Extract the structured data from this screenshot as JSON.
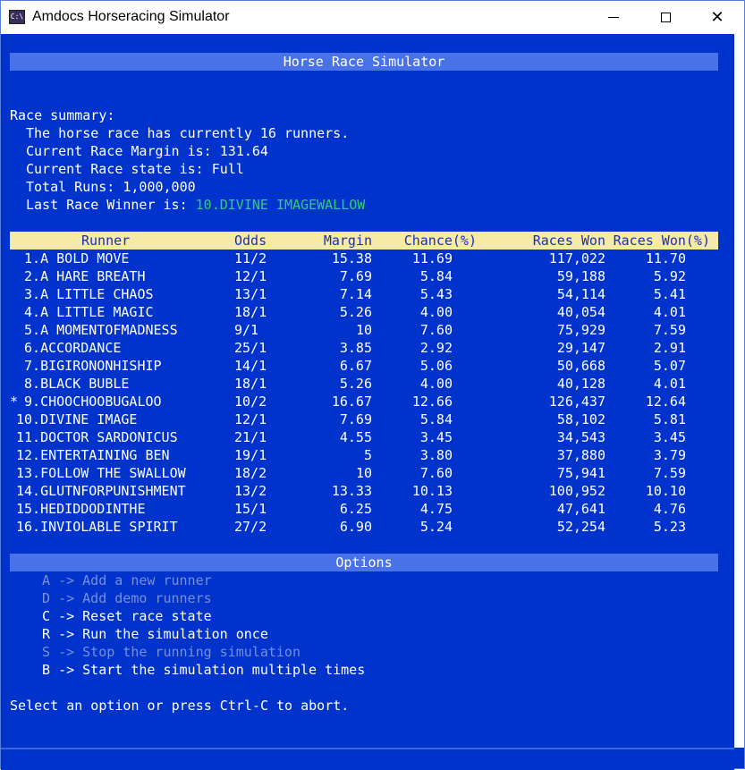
{
  "window": {
    "title": "Amdocs Horseracing Simulator",
    "icon": "console-app-icon"
  },
  "banner": {
    "title": "Horse Race Simulator"
  },
  "summary": {
    "heading": "Race summary:",
    "runners_line": "The horse race has currently 16 runners.",
    "margin_line": "Current Race Margin is: 131.64",
    "state_line": "Current Race state is: Full",
    "runs_line": "Total Runs: 1,000,000",
    "winner_label": "Last Race Winner is: ",
    "winner_value": "10.DIVINE IMAGEWALLOW",
    "winner_color": "#2fd16a"
  },
  "table": {
    "columns": [
      "Runner",
      "Odds",
      "Margin",
      "Chance(%)",
      "Races Won",
      "Races Won(%)"
    ],
    "rows": [
      {
        "marker": "",
        "runner": " 1.A BOLD MOVE",
        "odds": "11/2",
        "margin": "15.38",
        "chance": "11.69",
        "won": "117,022",
        "won_pct": "11.70"
      },
      {
        "marker": "",
        "runner": " 2.A HARE BREATH",
        "odds": "12/1",
        "margin": "7.69",
        "chance": "5.84",
        "won": "59,188",
        "won_pct": "5.92"
      },
      {
        "marker": "",
        "runner": " 3.A LITTLE CHAOS",
        "odds": "13/1",
        "margin": "7.14",
        "chance": "5.43",
        "won": "54,114",
        "won_pct": "5.41"
      },
      {
        "marker": "",
        "runner": " 4.A LITTLE MAGIC",
        "odds": "18/1",
        "margin": "5.26",
        "chance": "4.00",
        "won": "40,054",
        "won_pct": "4.01"
      },
      {
        "marker": "",
        "runner": " 5.A MOMENTOFMADNESS",
        "odds": "9/1",
        "margin": "10",
        "chance": "7.60",
        "won": "75,929",
        "won_pct": "7.59"
      },
      {
        "marker": "",
        "runner": " 6.ACCORDANCE",
        "odds": "25/1",
        "margin": "3.85",
        "chance": "2.92",
        "won": "29,147",
        "won_pct": "2.91"
      },
      {
        "marker": "",
        "runner": " 7.BIGIRONONHISHIP",
        "odds": "14/1",
        "margin": "6.67",
        "chance": "5.06",
        "won": "50,668",
        "won_pct": "5.07"
      },
      {
        "marker": "",
        "runner": " 8.BLACK BUBLE",
        "odds": "18/1",
        "margin": "5.26",
        "chance": "4.00",
        "won": "40,128",
        "won_pct": "4.01"
      },
      {
        "marker": "*",
        "runner": " 9.CHOOCHOOBUGALOO",
        "odds": "10/2",
        "margin": "16.67",
        "chance": "12.66",
        "won": "126,437",
        "won_pct": "12.64"
      },
      {
        "marker": "",
        "runner": "10.DIVINE IMAGE",
        "odds": "12/1",
        "margin": "7.69",
        "chance": "5.84",
        "won": "58,102",
        "won_pct": "5.81"
      },
      {
        "marker": "",
        "runner": "11.DOCTOR SARDONICUS",
        "odds": "21/1",
        "margin": "4.55",
        "chance": "3.45",
        "won": "34,543",
        "won_pct": "3.45"
      },
      {
        "marker": "",
        "runner": "12.ENTERTAINING BEN",
        "odds": "19/1",
        "margin": "5",
        "chance": "3.80",
        "won": "37,880",
        "won_pct": "3.79"
      },
      {
        "marker": "",
        "runner": "13.FOLLOW THE SWALLOW",
        "odds": "18/2",
        "margin": "10",
        "chance": "7.60",
        "won": "75,941",
        "won_pct": "7.59"
      },
      {
        "marker": "",
        "runner": "14.GLUTNFORPUNISHMENT",
        "odds": "13/2",
        "margin": "13.33",
        "chance": "10.13",
        "won": "100,952",
        "won_pct": "10.10"
      },
      {
        "marker": "",
        "runner": "15.HEDIDDODINTHE",
        "odds": "15/1",
        "margin": "6.25",
        "chance": "4.75",
        "won": "47,641",
        "won_pct": "4.76"
      },
      {
        "marker": "",
        "runner": "16.INVIOLABLE SPIRIT",
        "odds": "27/2",
        "margin": "6.90",
        "chance": "5.24",
        "won": "52,254",
        "won_pct": "5.23"
      }
    ]
  },
  "options": {
    "title": "Options",
    "items": [
      {
        "key": "A",
        "label": "Add a new runner",
        "enabled": false
      },
      {
        "key": "D",
        "label": "Add demo runners",
        "enabled": false
      },
      {
        "key": "C",
        "label": "Reset race state",
        "enabled": true
      },
      {
        "key": "R",
        "label": "Run the simulation once",
        "enabled": true
      },
      {
        "key": "S",
        "label": "Stop the running simulation",
        "enabled": false
      },
      {
        "key": "B",
        "label": "Start the simulation multiple times",
        "enabled": true
      }
    ],
    "arrow": "->"
  },
  "prompt": "Select an option or press Ctrl-C to abort.",
  "colors": {
    "background": "#0033cc",
    "banner": "#4a72e8",
    "header_bar": "#f6eaa6",
    "header_text": "#1a2fb8",
    "disabled": "#7a8fd6"
  }
}
